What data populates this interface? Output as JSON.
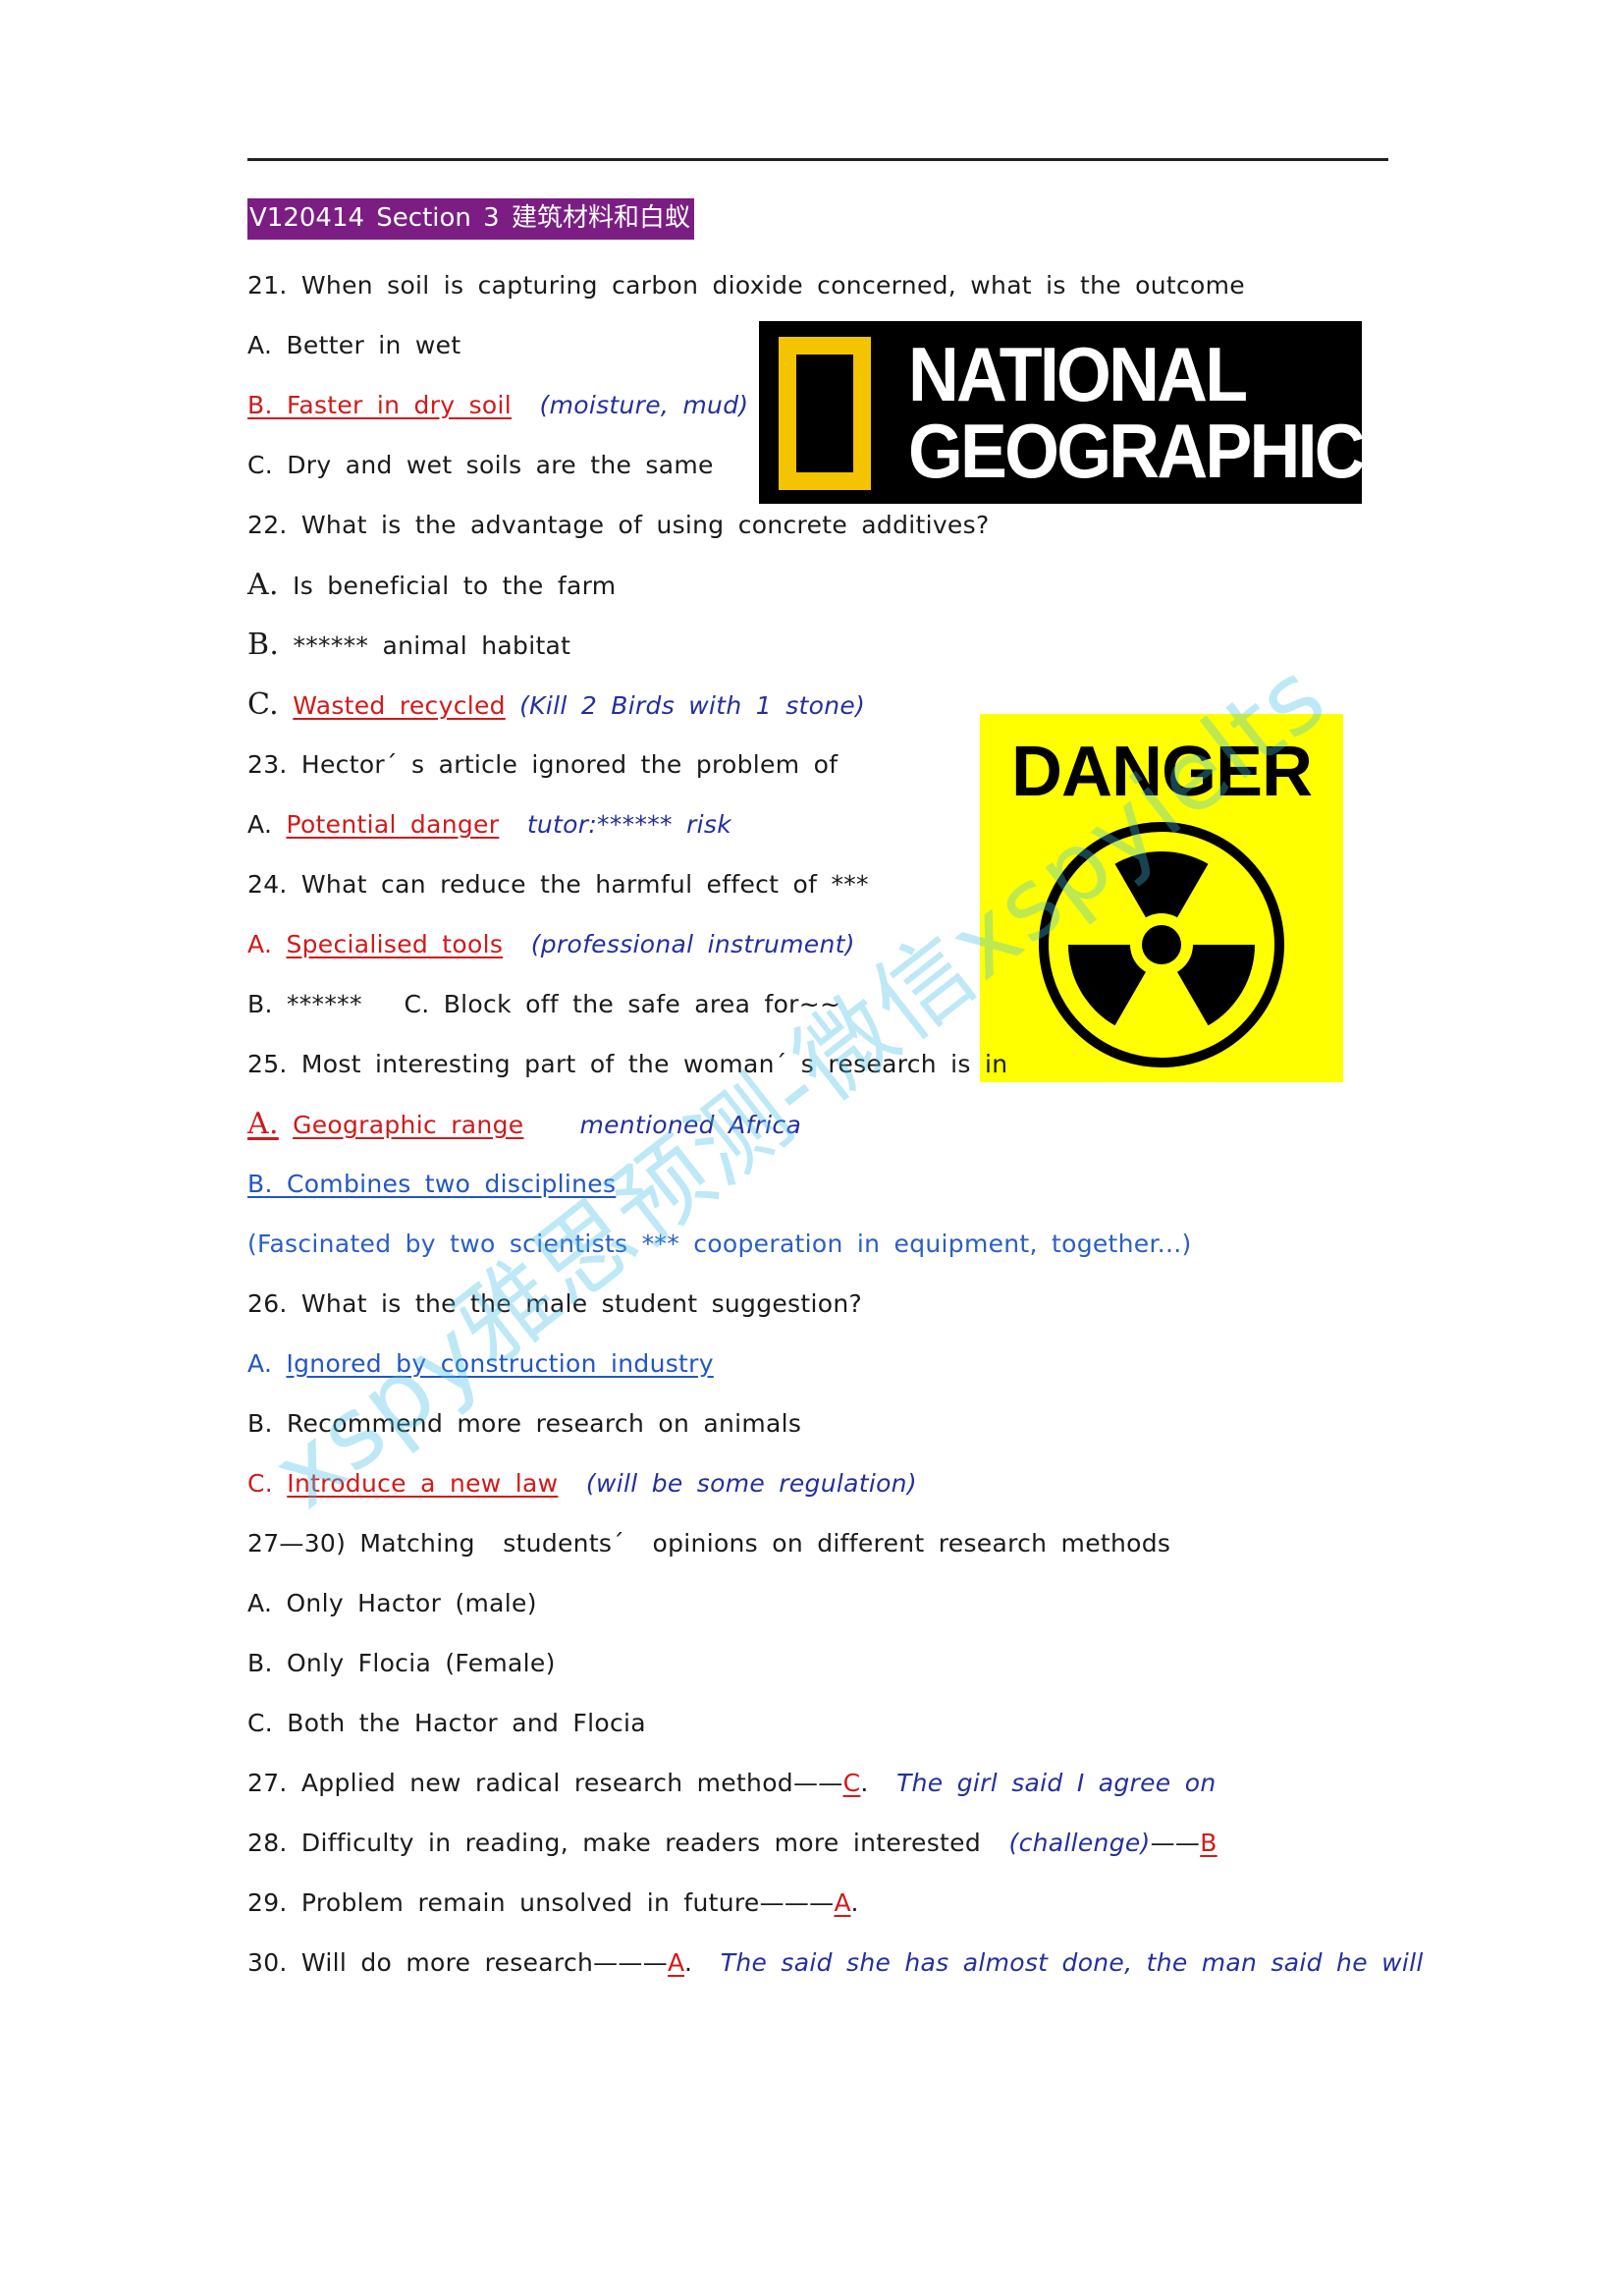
{
  "header": "V120414 Section 3 建筑材料和白蚁",
  "logo_natgeo": {
    "line1": "NATIONAL",
    "line2": "GEOGRAPHIC"
  },
  "danger_sign": {
    "word": "DANGER"
  },
  "watermark": "xspy雅思预测-微信xspyielts",
  "q21": {
    "question": "21. When soil is capturing carbon dioxide concerned, what is the outcome",
    "a": "A. Better in wet",
    "b": "B. Faster in dry soil",
    "b_note": "(moisture, mud)",
    "c": "C. Dry and wet soils are the same"
  },
  "q22": {
    "question": "22. What is the advantage of using concrete additives?",
    "a_letter": "A.",
    "a": "Is beneficial to the farm",
    "b_letter": "B.",
    "b": "****** animal habitat",
    "c_letter": "C.",
    "c": "Wasted recycled",
    "c_note": "(Kill 2 Birds with 1 stone)"
  },
  "q23": {
    "question": "23. Hector´ s article ignored the problem of",
    "a_letter": "A.",
    "a": "Potential danger",
    "a_note": "tutor:****** risk"
  },
  "q24": {
    "question": "24. What can reduce the harmful effect of ***",
    "a_letter": "A.",
    "a": "Specialised tools",
    "a_note": "(professional instrument)",
    "bc": "B. ******   C. Block off the safe area for~~"
  },
  "q25": {
    "question": "25. Most interesting part of the woman´ s research is in",
    "a_letter": "A.",
    "a": "Geographic range",
    "a_note": "mentioned Africa",
    "b": "B. Combines two disciplines",
    "b_note": "(Fascinated by two scientists *** cooperation in equipment, together...)"
  },
  "q26": {
    "question": "26. What is the the male student suggestion?",
    "a_letter": "A.",
    "a": "Ignored by construction industry",
    "b": "B. Recommend more research on animals",
    "c_letter": "C.",
    "c": "Introduce a new law",
    "c_note": "(will be some regulation)"
  },
  "matching": {
    "title": "27—30) Matching  students´  opinions on different research methods",
    "opt_a": "A. Only Hactor (male)",
    "opt_b": "B. Only Flocia (Female)",
    "opt_c": "C. Both the Hactor and Flocia"
  },
  "q27": {
    "text": "27. Applied new radical research method——",
    "answer": "C",
    "end": ".",
    "note": "The girl said I agree on"
  },
  "q28": {
    "text": "28. Difficulty in reading, make readers more interested",
    "note": "(challenge)",
    "dash": "——",
    "answer": "B"
  },
  "q29": {
    "text": "29. Problem remain unsolved in future———",
    "answer": "A",
    "end": "."
  },
  "q30": {
    "text": "30. Will do more research———",
    "answer": "A",
    "end": ".",
    "note": "The said she has almost done, the man said he will"
  }
}
